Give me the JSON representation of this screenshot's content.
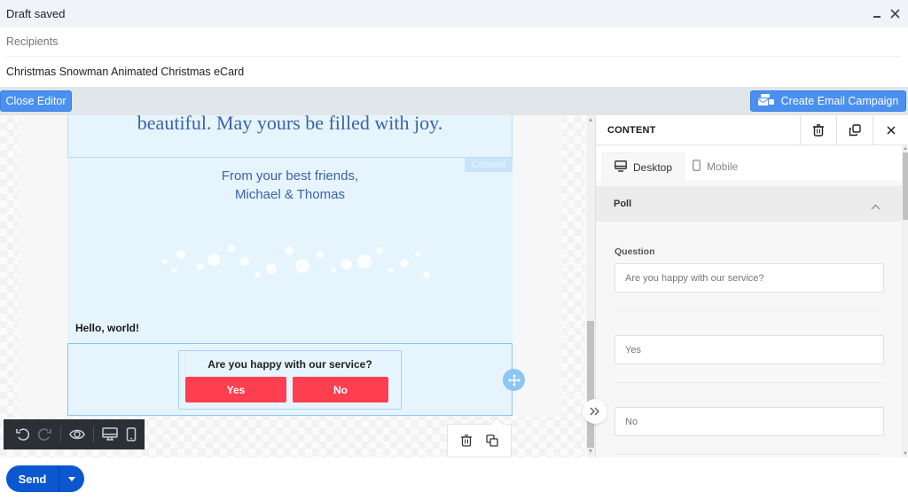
{
  "window": {
    "title": "Draft saved",
    "minimize_icon": "minimize-icon",
    "close_icon": "close-icon"
  },
  "compose": {
    "recipients_placeholder": "Recipients",
    "subject": "Christmas Snowman Animated Christmas eCard"
  },
  "editor_bar": {
    "close_editor_label": "Close Editor",
    "create_campaign_label": "Create Email Campaign",
    "create_campaign_icon": "campaign-icon"
  },
  "email": {
    "top_text": "beautiful. May yours be filled with joy.",
    "content_tag": "Content",
    "from_line1": "From your best friends,",
    "from_line2": "Michael & Thomas",
    "hello": "Hello, world!",
    "poll": {
      "question": "Are you happy with our service?",
      "options": [
        "Yes",
        "No"
      ],
      "button_color": "#ff3f4f"
    }
  },
  "block_tools": {
    "delete_icon": "trash-icon",
    "duplicate_icon": "duplicate-icon",
    "move_icon": "move-icon"
  },
  "toolbar": {
    "items": [
      "undo-icon",
      "redo-icon",
      "preview-icon",
      "desktop-icon",
      "mobile-icon"
    ]
  },
  "send": {
    "label": "Send",
    "more_icon": "dropdown-arrow-icon",
    "color": "#0b57d0"
  },
  "panel": {
    "title": "CONTENT",
    "tabs": [
      {
        "label": "Desktop",
        "icon": "desktop-icon",
        "active": true
      },
      {
        "label": "Mobile",
        "icon": "mobile-icon",
        "active": false
      }
    ],
    "section": "Poll",
    "question_label": "Question",
    "question_value": "Are you happy with our service?",
    "option_values": [
      "Yes",
      "No"
    ]
  },
  "colors": {
    "accent": "#4a90f0",
    "email_bg": "#e6f4fd",
    "text_blue": "#3b63a6"
  }
}
